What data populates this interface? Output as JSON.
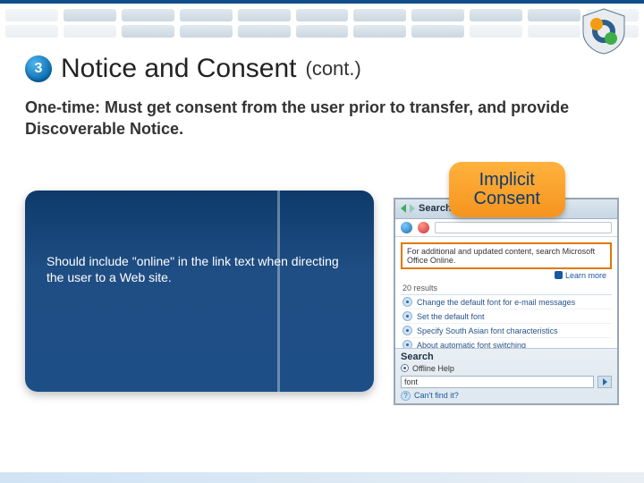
{
  "header": {
    "step_number": "3",
    "title": "Notice and Consent",
    "title_suffix": "(cont.)"
  },
  "subtitle": "One-time:  Must get consent from the user prior to transfer, and provide Discoverable Notice.",
  "badge": {
    "line1": "Implicit",
    "line2": "Consent"
  },
  "left_panel": {
    "text": "Should include \"online\" in the link text when directing the user to a Web site."
  },
  "screenshot": {
    "title": "Search Results",
    "note": "For additional and updated content, search Microsoft Office Online.",
    "learn_more": "Learn more",
    "result_count": "20 results",
    "results": [
      "Change the default font for e-mail messages",
      "Set the default font",
      "Specify South Asian font characteristics",
      "About automatic font switching"
    ],
    "footer": {
      "label": "Search",
      "radio": "Offline Help",
      "input_value": "font",
      "cant_find": "Can't find it?"
    }
  }
}
